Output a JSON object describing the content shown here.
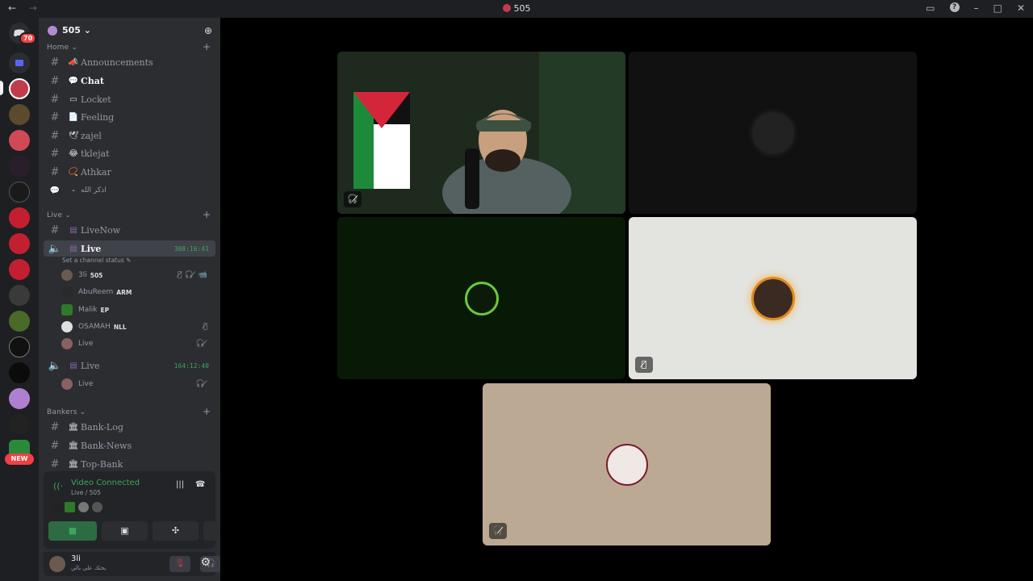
{
  "titlebar": {
    "title": "505",
    "back": "←",
    "fwd": "→"
  },
  "server": {
    "name": "505 ⌄"
  },
  "guilds": {
    "badge": "70",
    "new_label": "NEW"
  },
  "categories": {
    "home": "Home ⌄",
    "live": "Live ⌄",
    "bankers": "Bankers ⌄"
  },
  "channels": {
    "announcements": "Announcements",
    "chat": "Chat",
    "locket": "Locket",
    "feeling": "Feeling",
    "zajel": "zajel",
    "tklejat": "tklejat",
    "athkar": "Athkar",
    "athkar_ar": "اذكر الله",
    "livenow": "LiveNow",
    "live1": "Live",
    "live1_timer": "308:16:41",
    "live1_status": "Set a channel status",
    "live2": "Live",
    "live2_timer": "164:12:40",
    "banklog": "Bank-Log",
    "banknews": "Bank-News",
    "topbank": "Top-Bank"
  },
  "voice_users": [
    {
      "name": "3li",
      "tag": "505"
    },
    {
      "name": "AbuReem",
      "tag": "ARM"
    },
    {
      "name": "Malik",
      "tag": "EP"
    },
    {
      "name": "OSAMAH",
      "tag": "NLL"
    },
    {
      "name": "Live",
      "tag": ""
    },
    {
      "name": "Live",
      "tag": ""
    }
  ],
  "voice_panel": {
    "title": "Video Connected",
    "subtitle": "Live / 505"
  },
  "user": {
    "name": "3li",
    "status": "بحثك على بالي"
  },
  "colors": {
    "online": "#3ba55d",
    "brand": "#c23b4d",
    "sidebar": "#2b2d31"
  }
}
